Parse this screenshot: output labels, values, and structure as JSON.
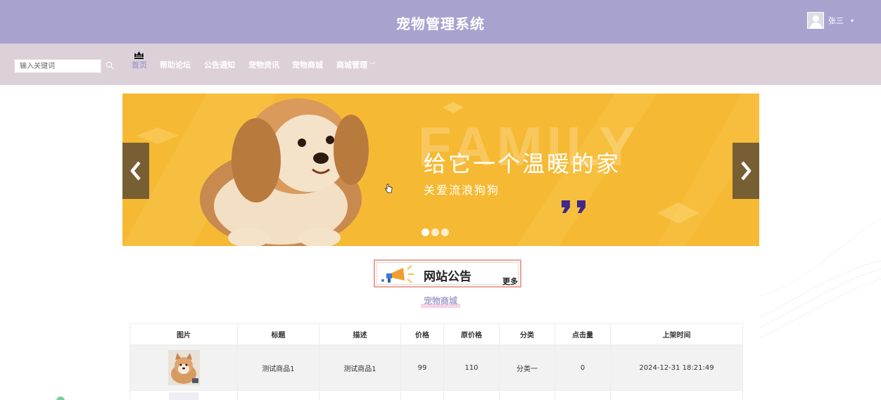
{
  "header": {
    "title": "宠物管理系统",
    "user_name": "张三",
    "user_caret": "▾",
    "colors": {
      "header_bg": "#a8a2cf",
      "nav_bg": "#dcd1d9",
      "accent": "#a8a2cf"
    }
  },
  "nav": {
    "search_placeholder": "输入关键词",
    "items": [
      {
        "label": "首页",
        "active": true
      },
      {
        "label": "帮助论坛"
      },
      {
        "label": "公告通知"
      },
      {
        "label": "宠物资讯"
      },
      {
        "label": "宠物商城"
      },
      {
        "label": "商城管理",
        "caret": "﹀"
      }
    ]
  },
  "banner": {
    "background_word": "FAMILY",
    "headline": "给它一个温暖的家",
    "subline": "关爱流浪狗狗",
    "slides": 3,
    "active_slide": 1
  },
  "notice": {
    "title": "网站公告",
    "more_label": "更多"
  },
  "shop": {
    "title": "宠物商城",
    "table": {
      "headers": [
        "图片",
        "标题",
        "描述",
        "价格",
        "原价格",
        "分类",
        "点击量",
        "上架时间"
      ],
      "rows": [
        {
          "image": "dog-photo",
          "title": "测试商品1",
          "description": "测试商品1",
          "price": "99",
          "original_price": "110",
          "category": "分类一",
          "clicks": "0",
          "listed_time": "2024-12-31 18:21:49"
        }
      ]
    }
  }
}
